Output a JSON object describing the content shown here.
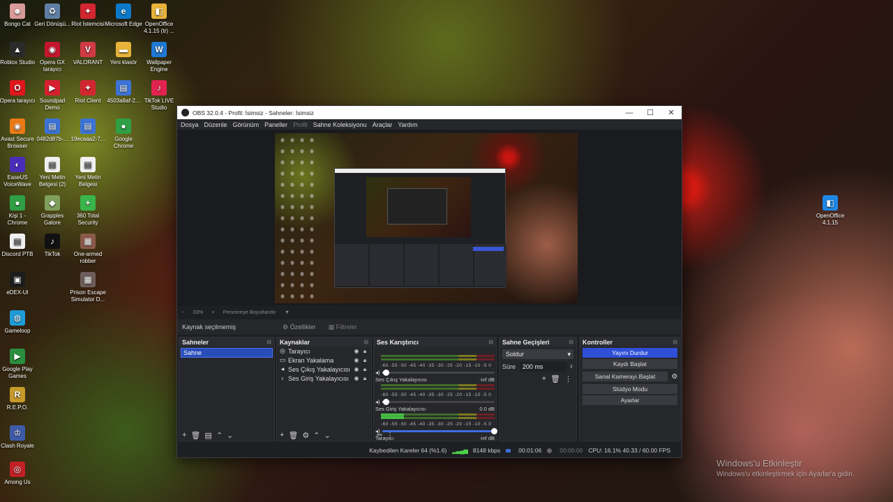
{
  "desktop": {
    "icons": [
      {
        "label": "Bongo Cat",
        "color": "#d99a9a"
      },
      {
        "label": "Geri Dönüşü...",
        "color": "#5f7ea3"
      },
      {
        "label": "Riot İstemcisi",
        "color": "#d22630"
      },
      {
        "label": "Roblox Studio",
        "color": "#2b2b2b"
      },
      {
        "label": "Opera GX tarayıcı",
        "color": "#c4162e"
      },
      {
        "label": "VALORANT",
        "color": "#d13a45"
      },
      {
        "label": "Microsoft Edge",
        "color": "#0c79c8"
      },
      {
        "label": "Opera tarayıcı",
        "color": "#e0171d"
      },
      {
        "label": "Soundpad Demo",
        "color": "#d7202f"
      },
      {
        "label": "Riot Client",
        "color": "#d22630"
      },
      {
        "label": "Yeni klasör",
        "color": "#e8b33a"
      },
      {
        "label": "OpenOffice 4.1.15 (tr) ...",
        "color": "#e8b33a"
      },
      {
        "label": "Avast Secure Browser",
        "color": "#ec7a14"
      },
      {
        "label": "0482d87b-...",
        "color": "#3b73d6"
      },
      {
        "label": "19ecaaa2-7...",
        "color": "#3b73d6"
      },
      {
        "label": "4503a8af-2...",
        "color": "#3b73d6"
      },
      {
        "label": "Wallpaper Engine",
        "color": "#1f78d1"
      },
      {
        "label": "EaseUS VoiceWave",
        "color": "#4a2cb8"
      },
      {
        "label": "Yeni Metin Belgesi (2)",
        "color": "#f0f0f0"
      },
      {
        "label": "Yeni Metin Belgesi",
        "color": "#f0f0f0"
      },
      {
        "label": "Google Chrome",
        "color": "#2f9e44"
      },
      {
        "label": "Kişi 1 - Chrome",
        "color": "#2f9e44"
      },
      {
        "label": "Grapples Galore",
        "color": "#7fa05c"
      },
      {
        "label": "360 Total Security",
        "color": "#39b54a"
      },
      {
        "label": "Discord PTB",
        "color": "#f0f0f0"
      },
      {
        "label": "TikTok",
        "color": "#111111"
      },
      {
        "label": "One-armed robber",
        "color": "#8a5a4a"
      },
      {
        "label": "TikTok LIVE Studio",
        "color": "#e0244f"
      },
      {
        "label": "eDEX-UI",
        "color": "#1c1c1c"
      },
      {
        "label": "Prison Escape Simulator D...",
        "color": "#6d5d5a"
      },
      {
        "label": "Gameloop",
        "color": "#1f9bd8"
      },
      {
        "label": "Google Play Games",
        "color": "#2a8e3e"
      },
      {
        "label": "R.E.P.O.",
        "color": "#c59a2b"
      },
      {
        "label": "Clash Royale",
        "color": "#3d5ba8"
      },
      {
        "label": "Among Us",
        "color": "#c02026"
      },
      {
        "label": "OpenOffice 4.1.15",
        "color": "#1e88e5"
      }
    ],
    "activation": {
      "title": "Windows'u Etkinleştir",
      "subtitle": "Windows'u etkinleştirmek için Ayarlar'a gidin."
    }
  },
  "obs": {
    "title": "OBS 32.0.4 - Profil: İsimsiz - Sahneler: İsimsiz",
    "window_buttons": [
      "—",
      "☐",
      "✕"
    ],
    "menu": [
      "Dosya",
      "Düzenle",
      "Görünüm",
      "Paneller",
      "Profil",
      "Sahne Koleksiyonu",
      "Araçlar",
      "Yardım"
    ],
    "zoombar": {
      "minus": "−",
      "zoom": "33%",
      "plus": "+",
      "fit": "Pencereye Boyutlandır",
      "arrow": "▼"
    },
    "source_bar": {
      "none_selected": "Kaynak seçilmemiş",
      "properties": "Özellikler",
      "filters": "Filtreler"
    },
    "scenes": {
      "title": "Sahneler",
      "items": [
        "Sahne"
      ]
    },
    "sources": {
      "title": "Kaynaklar",
      "items": [
        {
          "name": "Tarayıcı",
          "icon": "globe-icon",
          "glyph": "◎"
        },
        {
          "name": "Ekran Yakalama",
          "icon": "monitor-icon",
          "glyph": "▭"
        },
        {
          "name": "Ses Çıkış Yakalayıcısı",
          "icon": "speaker-icon",
          "glyph": "◂"
        },
        {
          "name": "Ses Giriş Yakalayıcısı",
          "icon": "microphone-icon",
          "glyph": "♀"
        }
      ]
    },
    "mixer": {
      "title": "Ses Karıştırıcı",
      "scale": "-60 -55 -50 -45 -40 -35 -30 -25 -20 -15 -10 -5 0",
      "channels": [
        {
          "name": "",
          "db": "",
          "level": 0.0,
          "volume": 0.04
        },
        {
          "name": "Ses Çıkış Yakalayıcısı",
          "db": "-inf dB",
          "level": 0.0,
          "volume": 0.04
        },
        {
          "name": "Ses Giriş Yakalayıcısı",
          "db": "0.0 dB",
          "level": 0.2,
          "volume": 1.0
        },
        {
          "name": "Tarayıcı",
          "db": "-inf dB",
          "level": 0.0,
          "volume": 0.0
        }
      ]
    },
    "transitions": {
      "title": "Sahne Geçişleri",
      "selected": "Soldur",
      "duration_label": "Süre",
      "duration": "200 ms"
    },
    "controls": {
      "title": "Kontroller",
      "stop_stream": "Yayını Durdur",
      "start_record": "Kaydı Başlat",
      "virtual_cam": "Sanal Kamerayı Başlat",
      "studio_mode": "Stüdyo Modu",
      "settings": "Ayarlar"
    },
    "status": {
      "dropped": "Kaybedilen Kareler 64 (%1.6)",
      "bitrate": "8148 kbps",
      "stream_time": "00:01:06",
      "record_time": "00:00:00",
      "cpu": "CPU: 16.1% 40.33 / 60.00 FPS"
    },
    "accent": "#2e4fd6"
  }
}
